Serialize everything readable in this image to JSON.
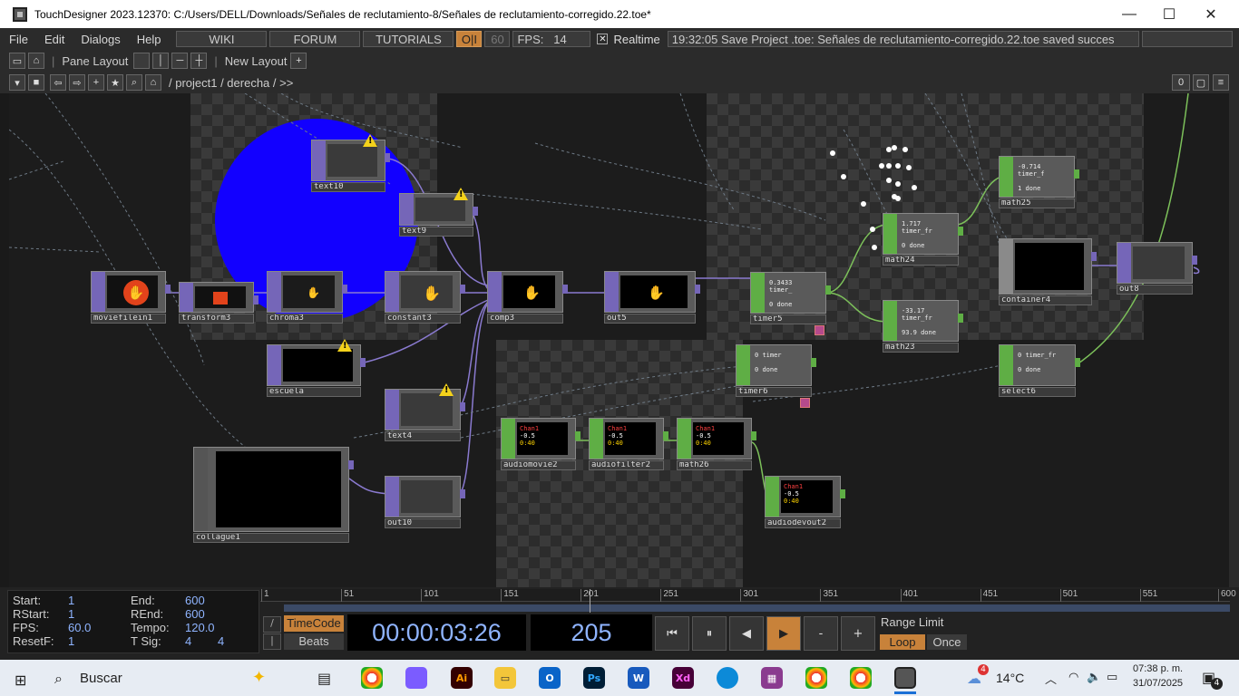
{
  "window": {
    "title": "TouchDesigner 2023.12370: C:/Users/DELL/Downloads/Señales de reclutamiento-8/Señales de reclutamiento-corregido.22.toe*",
    "minimize": "—",
    "maximize": "☐",
    "close": "✕"
  },
  "menu": {
    "items": [
      "File",
      "Edit",
      "Dialogs",
      "Help"
    ],
    "wiki": "WIKI",
    "forum": "FORUM",
    "tutorials": "TUTORIALS",
    "oi": "O|I",
    "fps_limit": "60",
    "fps_label": "FPS:",
    "fps_value": "14",
    "realtime": "Realtime",
    "status": "19:32:05 Save Project .toe: Señales de reclutamiento-corregido.22.toe saved succes"
  },
  "panebar": {
    "pane_layout": "Pane Layout",
    "new_layout": "New Layout"
  },
  "pathbar": {
    "path": "/ project1 / derecha / >>",
    "count": "0"
  },
  "nodes": [
    {
      "id": "text10",
      "label": "text10"
    },
    {
      "id": "text9",
      "label": "text9"
    },
    {
      "id": "moviefilein1",
      "label": "moviefilein1"
    },
    {
      "id": "transform3",
      "label": "transform3"
    },
    {
      "id": "chroma3",
      "label": "chroma3"
    },
    {
      "id": "constant3",
      "label": "constant3"
    },
    {
      "id": "comp3",
      "label": "comp3"
    },
    {
      "id": "out5",
      "label": "out5"
    },
    {
      "id": "timer5",
      "label": "timer5"
    },
    {
      "id": "math24",
      "label": "math24"
    },
    {
      "id": "math25",
      "label": "math25"
    },
    {
      "id": "math23",
      "label": "math23"
    },
    {
      "id": "container4",
      "label": "container4"
    },
    {
      "id": "out8",
      "label": "out8"
    },
    {
      "id": "escuela",
      "label": "escuela"
    },
    {
      "id": "text4",
      "label": "text4"
    },
    {
      "id": "timer6",
      "label": "timer6"
    },
    {
      "id": "select6",
      "label": "select6"
    },
    {
      "id": "audiomovie2",
      "label": "audiomovie2"
    },
    {
      "id": "audiofilter2",
      "label": "audiofilter2"
    },
    {
      "id": "math26",
      "label": "math26"
    },
    {
      "id": "audiodevout2",
      "label": "audiodevout2"
    },
    {
      "id": "collague1",
      "label": "collague1"
    },
    {
      "id": "out10",
      "label": "out10"
    }
  ],
  "node_text": {
    "math25": [
      "-0.714",
      "timer_f",
      "1",
      "done"
    ],
    "math24": [
      "1.717",
      "timer_fr",
      "0",
      "done"
    ],
    "timer5": [
      "0.3433",
      "timer_",
      "0",
      "done"
    ],
    "math23": [
      "-33.17",
      "timer_fr",
      "93.9",
      "done"
    ],
    "timer6": [
      "0",
      "timer",
      "0",
      "done"
    ],
    "select6": [
      "0",
      "timer_fr",
      "0",
      "done"
    ],
    "audio": [
      "Chan1",
      "-0.5",
      "Chan2",
      "0:40"
    ]
  },
  "timeline": {
    "start_label": "Start:",
    "start": "1",
    "end_label": "End:",
    "end": "600",
    "rstart_label": "RStart:",
    "rstart": "1",
    "rend_label": "REnd:",
    "rend": "600",
    "fps_label": "FPS:",
    "fps": "60.0",
    "tempo_label": "Tempo:",
    "tempo": "120.0",
    "resetf_label": "ResetF:",
    "resetf": "1",
    "tsig_label": "T Sig:",
    "tsig_a": "4",
    "tsig_b": "4",
    "ticks": [
      "1",
      "51",
      "101",
      "151",
      "201",
      "251",
      "301",
      "351",
      "401",
      "451",
      "501",
      "551",
      "600"
    ],
    "timecode_label": "TimeCode",
    "beats_label": "Beats",
    "timecode": "00:00:03:26",
    "frame": "205",
    "range_limit": "Range Limit",
    "loop": "Loop",
    "once": "Once",
    "plus": "+",
    "minus": "-"
  },
  "taskbar": {
    "search": "Buscar",
    "weather": "14°C",
    "time": "07:38 p. m.",
    "date": "31/07/2025",
    "notif_count": "4",
    "weather_badge": "4"
  }
}
